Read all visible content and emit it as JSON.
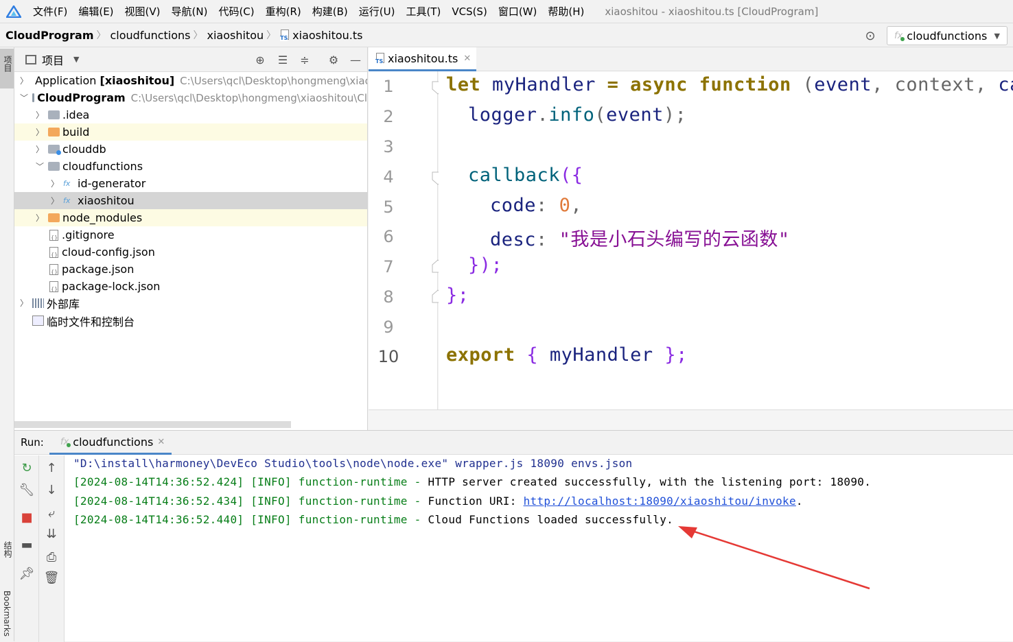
{
  "menubar": {
    "items": [
      "文件(F)",
      "编辑(E)",
      "视图(V)",
      "导航(N)",
      "代码(C)",
      "重构(R)",
      "构建(B)",
      "运行(U)",
      "工具(T)",
      "VCS(S)",
      "窗口(W)",
      "帮助(H)"
    ],
    "window_title": "xiaoshitou - xiaoshitou.ts [CloudProgram]"
  },
  "breadcrumb": [
    "CloudProgram",
    "cloudfunctions",
    "xiaoshitou",
    "xiaoshitou.ts"
  ],
  "run_config": {
    "label": "cloudfunctions"
  },
  "left_strip": {
    "project": "项目",
    "structure": "结构",
    "bookmarks": "Bookmarks"
  },
  "project_panel": {
    "title": "项目",
    "tree": [
      {
        "label": "Application",
        "bold_suffix": "[xiaoshitou]",
        "path": "C:\\Users\\qcl\\Desktop\\hongmeng\\xiaos"
      },
      {
        "label": "CloudProgram",
        "path": "C:\\Users\\qcl\\Desktop\\hongmeng\\xiaoshitou\\Cl"
      },
      {
        "label": ".idea"
      },
      {
        "label": "build"
      },
      {
        "label": "clouddb"
      },
      {
        "label": "cloudfunctions"
      },
      {
        "label": "id-generator"
      },
      {
        "label": "xiaoshitou"
      },
      {
        "label": "node_modules"
      },
      {
        "label": ".gitignore"
      },
      {
        "label": "cloud-config.json"
      },
      {
        "label": "package.json"
      },
      {
        "label": "package-lock.json"
      },
      {
        "label": "外部库"
      },
      {
        "label": "临时文件和控制台"
      }
    ]
  },
  "editor": {
    "tab": "xiaoshitou.ts",
    "line_numbers": [
      "1",
      "2",
      "3",
      "4",
      "5",
      "6",
      "7",
      "8",
      "9",
      "10"
    ],
    "code": {
      "l1_let": "let",
      "l1_name": "myHandler",
      "l1_eq": "=",
      "l1_async": "async",
      "l1_function": "function",
      "l1_paren": "(",
      "l1_event": "event",
      "l1_c1": ",",
      "l1_context": "context",
      "l1_c2": ",",
      "l1_call": "call",
      "l2_logger": "logger",
      "l2_dot": ".",
      "l2_info": "info",
      "l2_open": "(",
      "l2_event": "event",
      "l2_close": ");",
      "l4_callback": "callback",
      "l4_open": "({",
      "l5_code": "code",
      "l5_colon": ":",
      "l5_val": "0",
      "l5_comma": ",",
      "l6_desc": "desc",
      "l6_colon": ":",
      "l6_val": "\"我是小石头编写的云函数\"",
      "l7_close": "});",
      "l8_close": "};",
      "l10_export": "export",
      "l10_open": "{",
      "l10_name": "myHandler",
      "l10_close": "};"
    }
  },
  "run_panel": {
    "label": "Run:",
    "tab": "cloudfunctions",
    "console": {
      "line1": "\"D:\\install\\harmoney\\DevEco Studio\\tools\\node\\node.exe\" wrapper.js 18090 envs.json",
      "line2_prefix": "[2024-08-14T14:36:52.424] [INFO] function-runtime - ",
      "line2_msg": "HTTP server created successfully, with the listening port: 18090.",
      "line3_prefix": "[2024-08-14T14:36:52.434] [INFO] function-runtime - ",
      "line3_msg": "Function URI: ",
      "line3_link": "http://localhost:18090/xiaoshitou/invoke",
      "line3_end": ".",
      "line4_prefix": "[2024-08-14T14:36:52.440] [INFO] function-runtime - ",
      "line4_msg": "Cloud Functions loaded successfully."
    }
  },
  "colors": {
    "accent": "#4a86c8",
    "annotation_arrow": "#e53935",
    "current_line": "#fdfbe3"
  }
}
